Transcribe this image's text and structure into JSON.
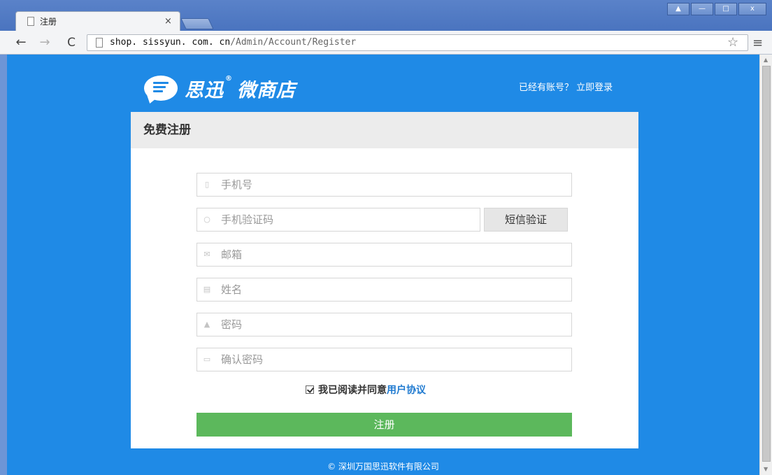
{
  "browser": {
    "tab_title": "注册",
    "tab_close": "×",
    "url_host": "shop. sissyun. com. cn",
    "url_path": "/Admin/Account/Register",
    "window_buttons": [
      "▲",
      "—",
      "□",
      "x"
    ]
  },
  "header": {
    "logo_text_1": "思迅",
    "logo_reg": "®",
    "logo_text_2": "微商店",
    "login_link": "已经有账号？ 立即登录"
  },
  "form": {
    "title": "免费注册",
    "fields": {
      "phone": {
        "placeholder": "手机号",
        "icon": "phone-icon"
      },
      "sms_code": {
        "placeholder": "手机验证码",
        "icon": "chat-icon"
      },
      "email": {
        "placeholder": "邮箱",
        "icon": "envelope-icon"
      },
      "name": {
        "placeholder": "姓名",
        "icon": "id-card-icon"
      },
      "password": {
        "placeholder": "密码",
        "icon": "lock-icon"
      },
      "confirm_password": {
        "placeholder": "确认密码",
        "icon": "keyboard-icon"
      }
    },
    "sms_button": "短信验证",
    "agree_text": "我已阅读并同意",
    "agree_link": "用户协议",
    "agree_checked": true,
    "submit_label": "注册"
  },
  "footer": {
    "copyright": "© 深圳万国思迅软件有限公司"
  },
  "colors": {
    "page_bg": "#1f8ae6",
    "submit": "#5cb85c",
    "link": "#1f7ad0"
  }
}
